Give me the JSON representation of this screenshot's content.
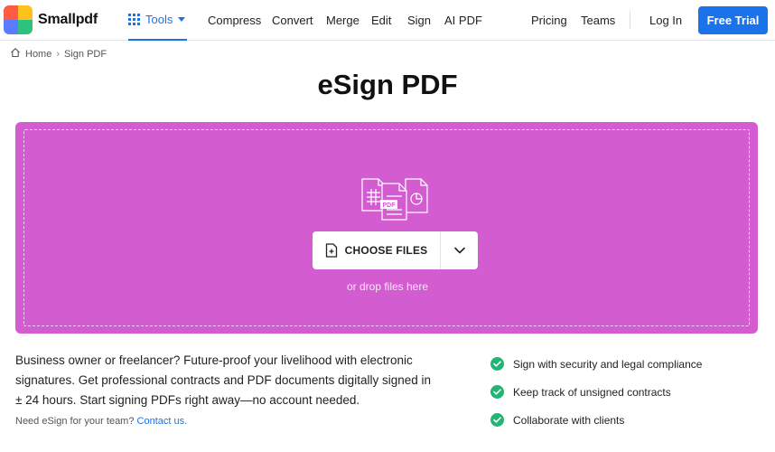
{
  "brand": {
    "name": "Smallpdf",
    "logo_colors": [
      "#ff5a43",
      "#ffc21c",
      "#5b7cff",
      "#2ec27e"
    ]
  },
  "nav": {
    "tools_label": "Tools",
    "links": [
      "Compress",
      "Convert",
      "Merge",
      "Edit",
      "Sign",
      "AI PDF"
    ],
    "pricing": "Pricing",
    "teams": "Teams",
    "login": "Log In",
    "cta": "Free Trial"
  },
  "breadcrumb": {
    "home": "Home",
    "current": "Sign PDF"
  },
  "page": {
    "title": "eSign PDF"
  },
  "dropzone": {
    "button_label": "CHOOSE FILES",
    "hint": "or drop files here",
    "color": "#d35dd0",
    "illustration_badge": "PDF"
  },
  "description": {
    "text": "Business owner or freelancer? Future-proof your livelihood with electronic signatures. Get professional contracts and PDF documents digitally signed in ± 24 hours. Start signing PDFs right away—no account needed.",
    "team_prefix": "Need eSign for your team?",
    "team_link": "Contact us."
  },
  "features": [
    "Sign with security and legal compliance",
    "Keep track of unsigned contracts",
    "Collaborate with clients"
  ],
  "colors": {
    "accent": "#1a73e8",
    "check": "#22b573"
  }
}
